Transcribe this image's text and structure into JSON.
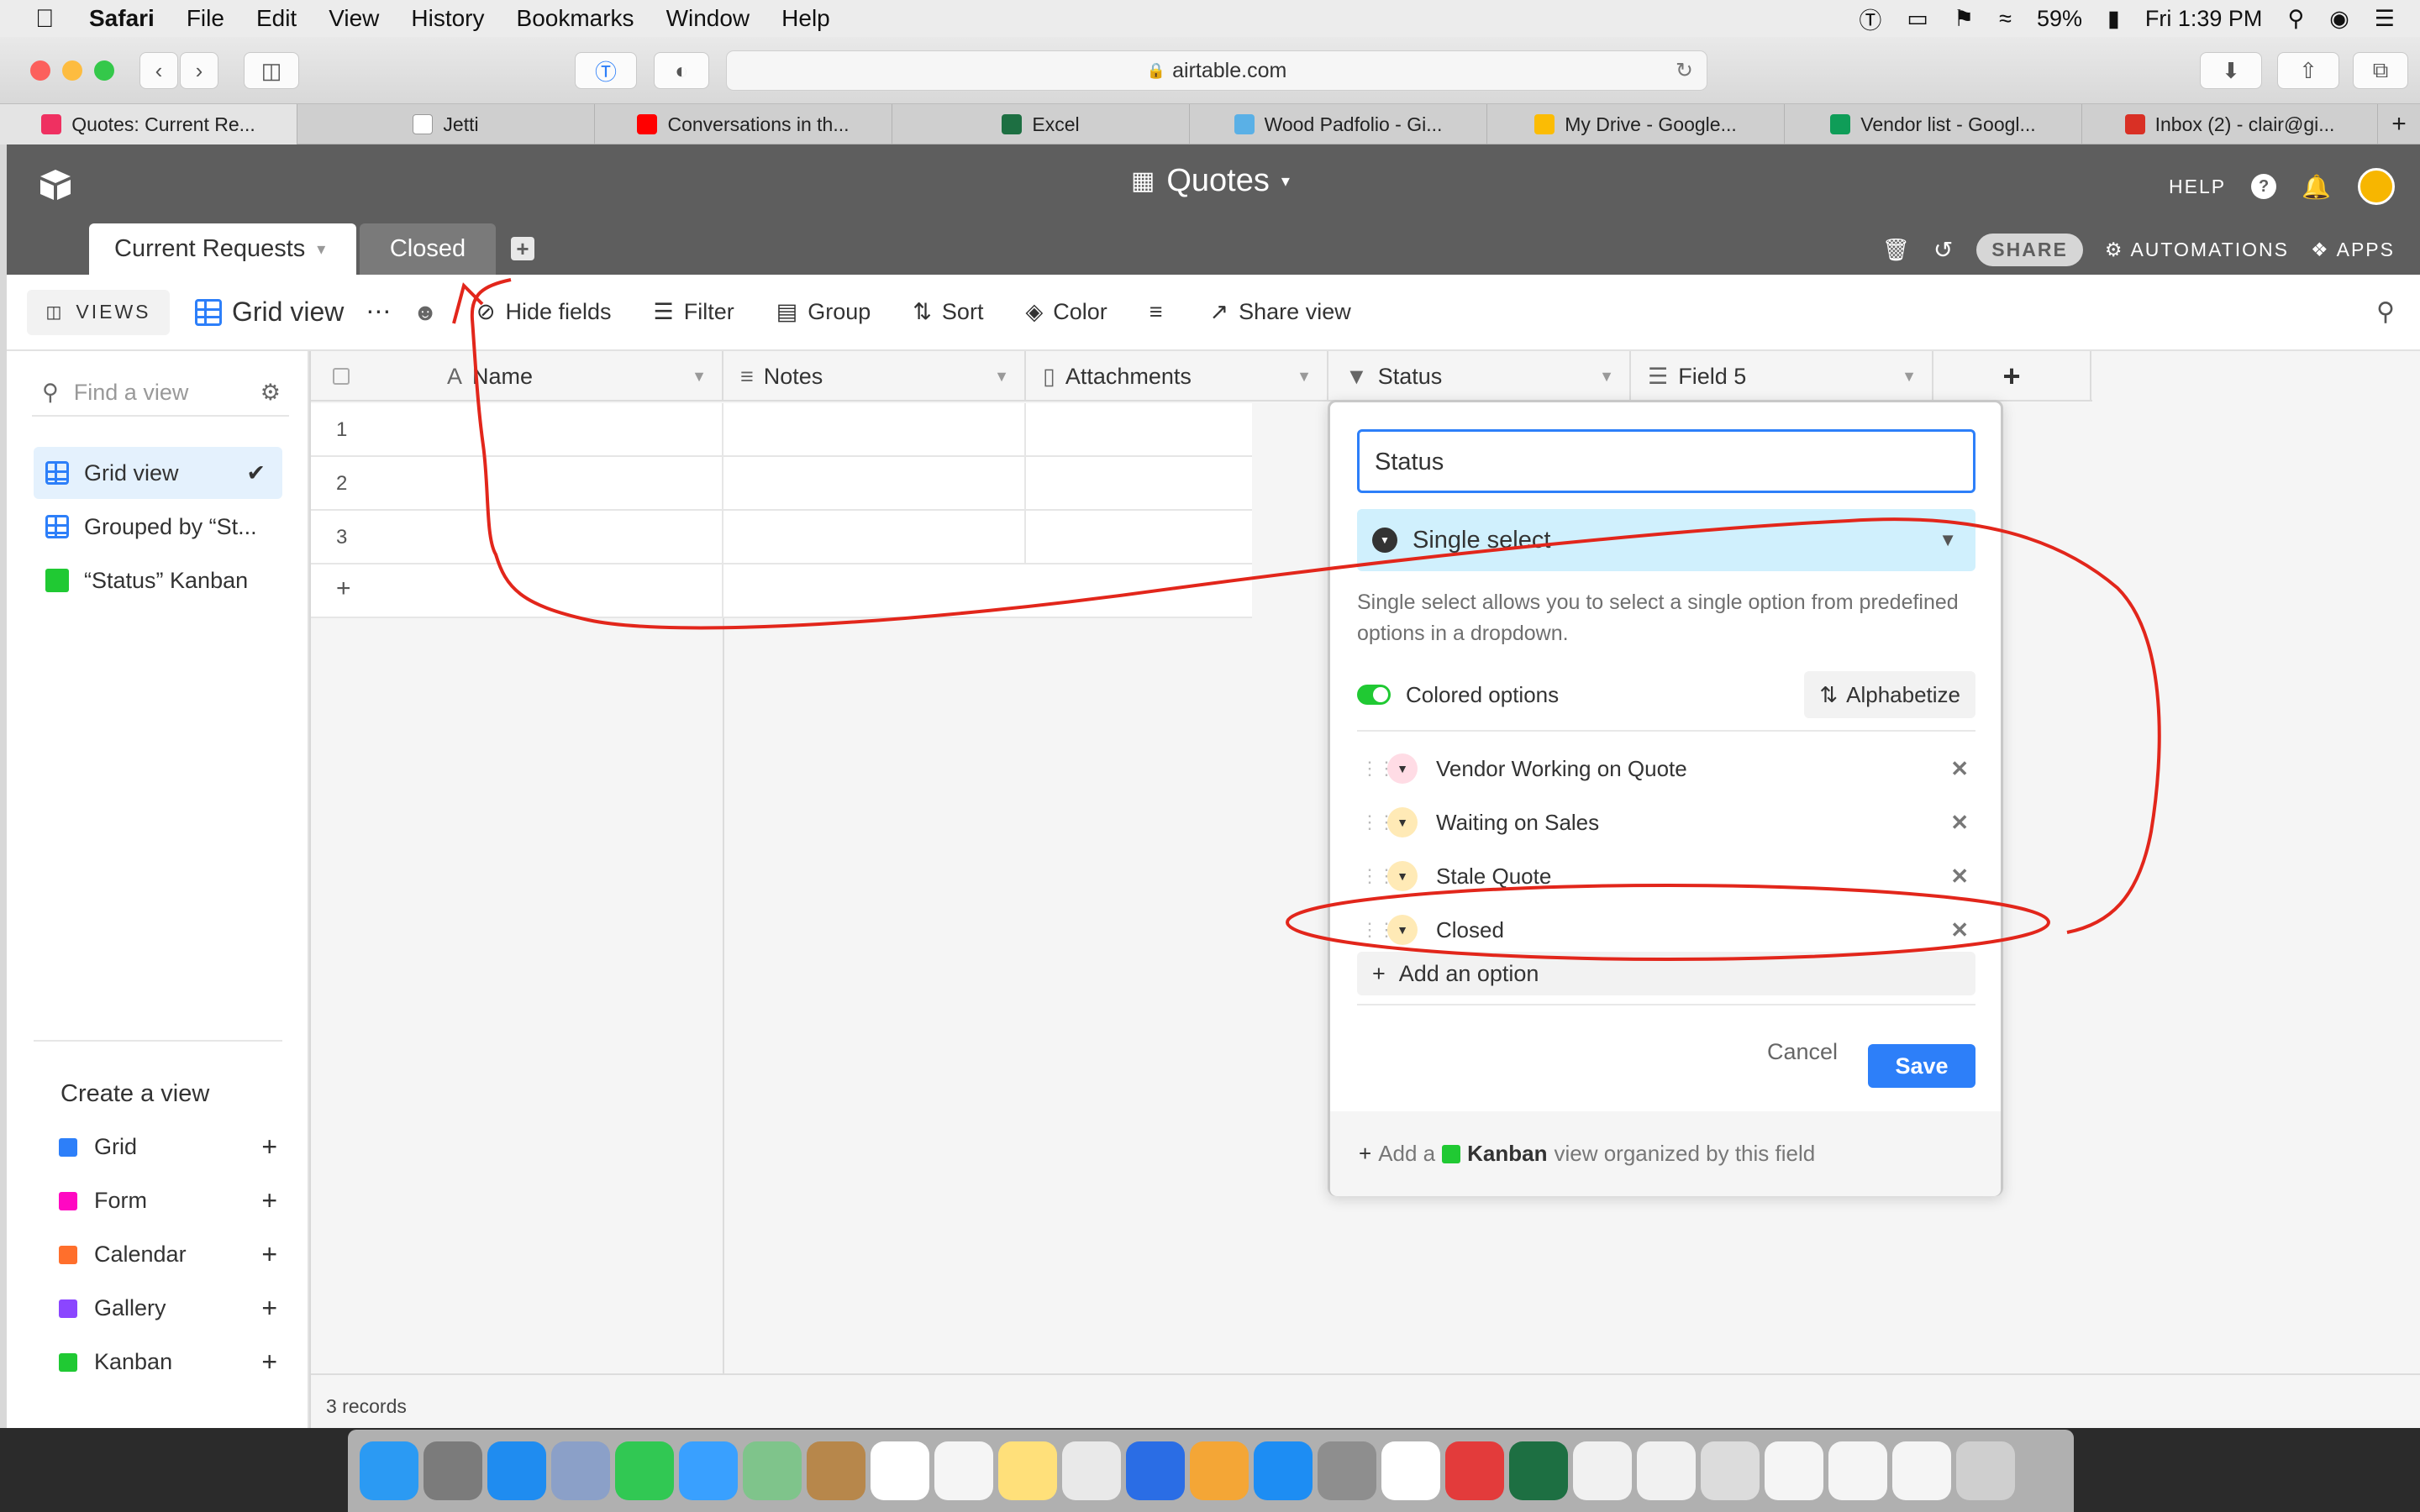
{
  "menubar": {
    "app": "Safari",
    "items": [
      "File",
      "Edit",
      "View",
      "History",
      "Bookmarks",
      "Window",
      "Help"
    ],
    "battery": "59%",
    "clock": "Fri 1:39 PM"
  },
  "browser": {
    "url": "airtable.com",
    "tabs": [
      {
        "label": "Quotes: Current Re...",
        "color": "#ef3061"
      },
      {
        "label": "Jetti",
        "color": "#ffffff"
      },
      {
        "label": "Conversations in th...",
        "color": "#ff0000"
      },
      {
        "label": "Excel",
        "color": "#1d6f42"
      },
      {
        "label": "Wood Padfolio - Gi...",
        "color": "#5ab0e6"
      },
      {
        "label": "My Drive - Google...",
        "color": "#fbbc04"
      },
      {
        "label": "Vendor list - Googl...",
        "color": "#0f9d58"
      },
      {
        "label": "Inbox (2) - clair@gi...",
        "color": "#d93025"
      }
    ]
  },
  "header": {
    "base_title": "Quotes",
    "help": "HELP",
    "share": "SHARE",
    "automations": "AUTOMATIONS",
    "apps": "APPS",
    "tables": [
      {
        "label": "Current Requests"
      },
      {
        "label": "Closed"
      }
    ]
  },
  "viewbar": {
    "views_label": "VIEWS",
    "view_name": "Grid view",
    "hide_fields": "Hide fields",
    "filter": "Filter",
    "group": "Group",
    "sort": "Sort",
    "color": "Color",
    "share_view": "Share view"
  },
  "sidebar": {
    "search_placeholder": "Find a view",
    "views": [
      {
        "label": "Grid view",
        "selected": true,
        "icon": "grid-icon"
      },
      {
        "label": "Grouped by “St...",
        "icon": "grid-icon"
      },
      {
        "label": "“Status” Kanban",
        "icon": "kanban-icon"
      }
    ],
    "create_header": "Create a view",
    "create": [
      {
        "label": "Grid",
        "color": "#2d7ff9"
      },
      {
        "label": "Form",
        "color": "#ff08c2"
      },
      {
        "label": "Calendar",
        "color": "#ff6f2c"
      },
      {
        "label": "Gallery",
        "color": "#8b46ff"
      },
      {
        "label": "Kanban",
        "color": "#20c933"
      }
    ]
  },
  "grid": {
    "columns": [
      "Name",
      "Notes",
      "Attachments",
      "Status",
      "Field 5"
    ],
    "rows": [
      "1",
      "2",
      "3"
    ],
    "add_row": "+",
    "add_col": "+",
    "record_count": "3 records"
  },
  "dialog": {
    "field_name": "Status",
    "field_type": "Single select",
    "description": "Single select allows you to select a single option from predefined options in a dropdown.",
    "colored_options": "Colored options",
    "alphabetize": "Alphabetize",
    "options": [
      {
        "label": "Vendor Working on Quote",
        "color": "#ffdce5"
      },
      {
        "label": "Waiting on Sales",
        "color": "#ffeab6"
      },
      {
        "label": "Stale Quote",
        "color": "#ffeab6"
      },
      {
        "label": "Closed",
        "color": "#ffeab6"
      }
    ],
    "add_option": "Add an option",
    "cancel": "Cancel",
    "save": "Save",
    "footer_prefix": "Add a",
    "footer_kanban": "Kanban",
    "footer_suffix": "view organized by this field"
  }
}
